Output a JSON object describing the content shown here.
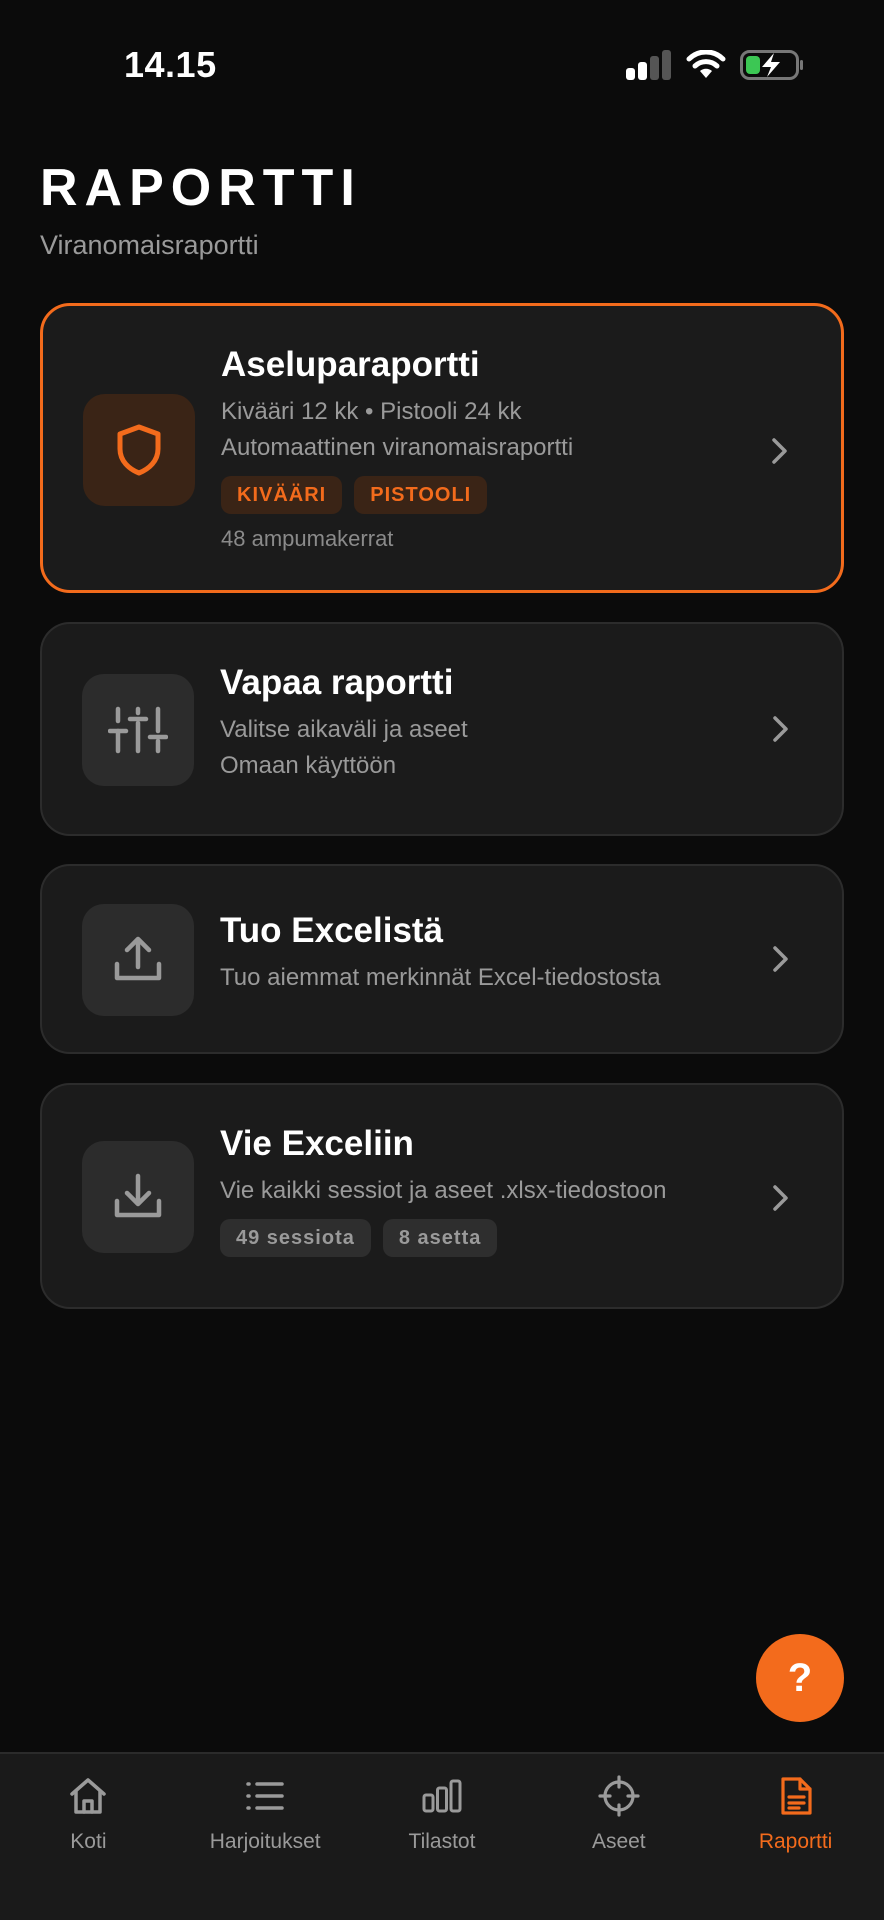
{
  "status_bar": {
    "time": "14.15"
  },
  "header": {
    "title": "RAPORTTI",
    "subtitle": "Viranomaisraportti"
  },
  "cards": [
    {
      "title": "Aseluparaportti",
      "lines": [
        "Kivääri 12 kk • Pistooli 24 kk",
        "Automaattinen viranomaisraportti"
      ],
      "chips": [
        "KIVÄÄRI",
        "PISTOOLI"
      ],
      "meta": "48 ampumakerrat",
      "icon": "shield-icon"
    },
    {
      "title": "Vapaa raportti",
      "lines": [
        "Valitse aikaväli ja aseet",
        "Omaan käyttöön"
      ],
      "icon": "sliders-icon"
    },
    {
      "title": "Tuo Excelistä",
      "lines": [
        "Tuo aiemmat merkinnät Excel-tiedostosta"
      ],
      "icon": "upload-icon"
    },
    {
      "title": "Vie Exceliin",
      "lines": [
        "Vie kaikki sessiot ja aseet .xlsx-tiedostoon"
      ],
      "chips": [
        "49 sessiota",
        "8 asetta"
      ],
      "icon": "download-icon"
    }
  ],
  "fab": {
    "label": "?"
  },
  "tabs": [
    {
      "label": "Koti",
      "icon": "home-icon"
    },
    {
      "label": "Harjoitukset",
      "icon": "list-icon"
    },
    {
      "label": "Tilastot",
      "icon": "bar-chart-icon"
    },
    {
      "label": "Aseet",
      "icon": "crosshair-icon"
    },
    {
      "label": "Raportti",
      "icon": "document-icon"
    }
  ],
  "colors": {
    "accent": "#f36b1c",
    "background": "#0b0b0b",
    "card": "#1b1b1b"
  }
}
